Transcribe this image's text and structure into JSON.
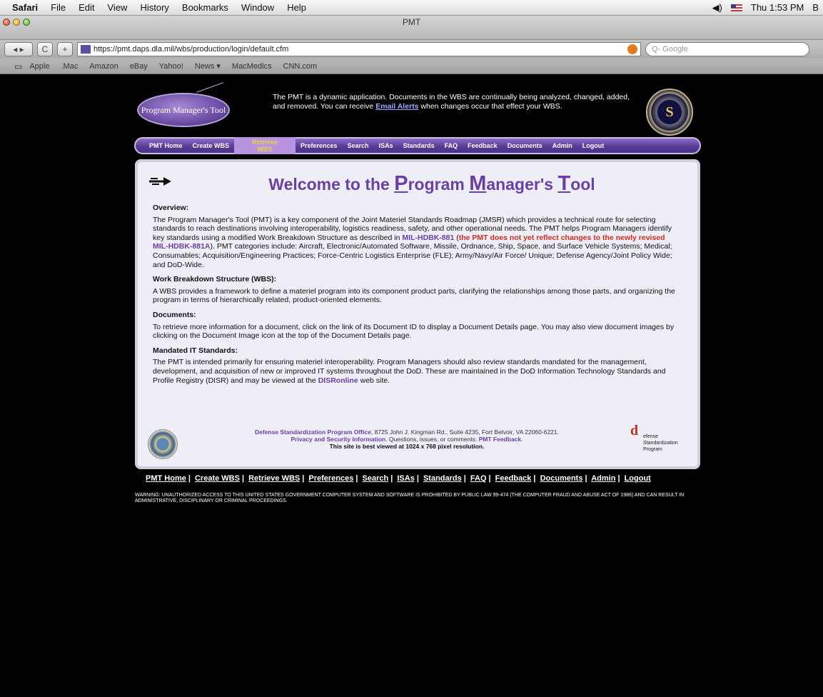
{
  "menubar": {
    "items": [
      "Safari",
      "File",
      "Edit",
      "View",
      "History",
      "Bookmarks",
      "Window",
      "Help"
    ],
    "clock": "Thu 1:53 PM",
    "trailing": "B"
  },
  "window": {
    "title": "PMT"
  },
  "toolbar": {
    "back_label": "◂ ▸",
    "reload_label": "C",
    "add_label": "+",
    "url": "https://pmt.daps.dla.mil/wbs/production/login/default.cfm",
    "search_placeholder": "Q- Google"
  },
  "bookmarks": [
    "Apple",
    ".Mac",
    "Amazon",
    "eBay",
    "Yahoo!",
    "News ▾",
    "MacMedics",
    "CNN.com"
  ],
  "header": {
    "logo_text": "Program Manager's Tool",
    "intro_before": "The PMT is a dynamic application. Documents in the WBS are continually being analyzed, changed, added, and removed. You can receive ",
    "intro_link": "Email Alerts",
    "intro_after": " when changes occur that effect your WBS.",
    "seal_letter": "S"
  },
  "nav": {
    "items": [
      "PMT Home",
      "Create WBS",
      "Retrieve WBS",
      "Preferences",
      "Search",
      "ISAs",
      "Standards",
      "FAQ",
      "Feedback",
      "Documents",
      "Admin",
      "Logout"
    ],
    "active_index": 2
  },
  "welcome": {
    "prefix": "Welcome to the ",
    "p": "P",
    "rogram": "rogram ",
    "m": "M",
    "anagers": "anager's ",
    "t": "T",
    "ool": "ool"
  },
  "sections": {
    "overview": {
      "title": "Overview:",
      "body_1": "The Program Manager's Tool (PMT) is a key component of the Joint Materiel Standards Roadmap (JMSR) which provides a technical route for selecting standards to reach destinations involving interoperability, logistics readiness, safety, and other operational needs. The PMT helps Program Managers identify key standards using a modified Work Breakdown Structure as described in ",
      "link_1": "MIL-HDBK-881",
      "paren_open": " (",
      "note": "the PMT does not yet reflect changes to the newly revised ",
      "link_2": "MIL-HDBK-881A",
      "body_2": "). PMT categories include: Aircraft, Electronic/Automated Software, Missile, Ordnance, Ship, Space, and Surface Vehicle Systems; Medical; Consumables; Acquisition/Engineering Practices; Force-Centric Logistics Enterprise (FLE); Army/Navy/Air Force/ Unique; Defense Agency/Joint Policy Wide; and DoD-Wide."
    },
    "wbs": {
      "title": "Work Breakdown Structure (WBS):",
      "body": "A WBS provides a framework to define a materiel program into its component product parts, clarifying the relationships among those parts, and organizing the program in terms of hierarchically related, product-oriented elements."
    },
    "documents": {
      "title": "Documents:",
      "body": "To retrieve more information for a document, click on the link of its Document ID to display a Document Details page. You may also view document images by clicking on the Document Image icon at the top of the Document Details page."
    },
    "mandated": {
      "title": "Mandated IT Standards:",
      "body": "The PMT is intended primarily for ensuring materiel interoperability. Program Managers should also review standards mandated for the management, development, and acquisition of new or improved IT systems throughout the DoD. These are maintained in the DoD Information Technology Standards and Profile Registry (DISR) and may be viewed at the ",
      "link": "DISRonline",
      "tail": " web site."
    }
  },
  "footer": {
    "org": "Defense Standardization Program Office",
    "address": ", 8725 John J. Kingman Rd., Suite 4235, Fort Belvoir, VA 22060-6221.",
    "privacy": "Privacy and Security Information",
    "questions": ". Questions, issues, or comments: ",
    "feedback": "PMT Feedback",
    "period": ".",
    "best": "This site is best viewed at 1024 x 768 pixel resolution.",
    "dsp_line1": "efense",
    "dsp_line2": "Standardization",
    "dsp_line3": "Program"
  },
  "bottom_nav": [
    "PMT Home",
    "Create WBS",
    "Retrieve WBS",
    "Preferences",
    "Search",
    "ISAs",
    "Standards",
    "FAQ",
    "Feedback",
    "Documents",
    "Admin",
    "Logout"
  ],
  "warning": "WARNING: UNAUTHORIZED ACCESS TO THIS UNITED STATES GOVERNMENT COMPUTER SYSTEM AND SOFTWARE IS PROHIBITED BY PUBLIC LAW 99-474 (THE COMPUTER FRAUD AND ABUSE ACT OF 1986) AND CAN RESULT IN ADMINISTRATIVE, DISCIPLINARY OR CRIMINAL PROCEEDINGS."
}
